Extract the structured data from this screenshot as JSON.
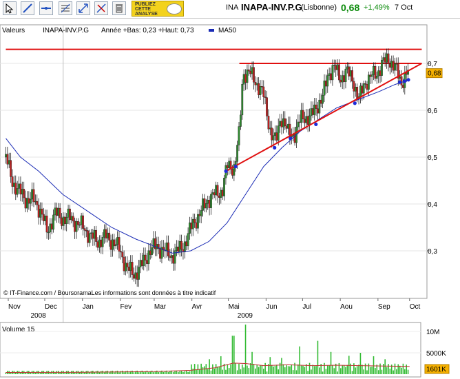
{
  "toolbar": {
    "tools": [
      "cursor-tool",
      "trendline-tool",
      "horizontal-line-tool",
      "fibonacci-tool",
      "resize-tool",
      "eraser-tool",
      "delete-tool"
    ],
    "ad_lines": [
      "PUBLIEZ",
      "CETTE",
      "ANALYSE"
    ]
  },
  "header": {
    "code": "INA",
    "name": "INAPA-INV.P.G",
    "market": "(Lisbonne)",
    "price": "0,68",
    "change": "+1,49%",
    "date": "7 Oct"
  },
  "colors": {
    "candle_up": "#2f8a2f",
    "candle_down": "#c02020",
    "ma": "#1a2bb5",
    "trendline": "#e01010",
    "volume_bar": "#33bb33",
    "volume_ma": "#c03030",
    "marker": "#1d2bd8",
    "price_tag": "#f5b000"
  },
  "chart_data": [
    {
      "type": "line",
      "subtype": "candlestick",
      "legend": {
        "label": "Valeurs",
        "symbol": "INAPA-INV.P.G",
        "range": "Année +Bas: 0,23 +Haut: 0,73",
        "ma_label": "MA50"
      },
      "ylim": [
        0.22,
        0.78
      ],
      "y_ticks": [
        "0,3",
        "0,4",
        "0,5",
        "0,6",
        "0,7"
      ],
      "y_tick_values": [
        0.3,
        0.4,
        0.5,
        0.6,
        0.7
      ],
      "x_range_days": 330,
      "x_month_labels": [
        "Nov",
        "Dec",
        "Jan",
        "Fev",
        "Mar",
        "Avr",
        "Mai",
        "Jun",
        "Jul",
        "Aou",
        "Sep",
        "Oct"
      ],
      "x_month_days": [
        0,
        30,
        61,
        92,
        120,
        151,
        181,
        212,
        242,
        273,
        304,
        330
      ],
      "x_year_labels": [
        "2008",
        "2009"
      ],
      "x_year_days": [
        15,
        185
      ],
      "last_price_label": "0,68",
      "copyright": "© IT-Finance.com / BoursoramaLes informations sont données à titre indicatif",
      "price_points": [
        [
          -2,
          0.5
        ],
        [
          3,
          0.45
        ],
        [
          8,
          0.43
        ],
        [
          14,
          0.41
        ],
        [
          20,
          0.41
        ],
        [
          26,
          0.39
        ],
        [
          32,
          0.34
        ],
        [
          38,
          0.38
        ],
        [
          44,
          0.37
        ],
        [
          50,
          0.37
        ],
        [
          56,
          0.36
        ],
        [
          62,
          0.35
        ],
        [
          68,
          0.33
        ],
        [
          74,
          0.32
        ],
        [
          80,
          0.33
        ],
        [
          86,
          0.32
        ],
        [
          92,
          0.3
        ],
        [
          98,
          0.26
        ],
        [
          104,
          0.25
        ],
        [
          110,
          0.27
        ],
        [
          116,
          0.3
        ],
        [
          122,
          0.31
        ],
        [
          128,
          0.3
        ],
        [
          134,
          0.29
        ],
        [
          140,
          0.3
        ],
        [
          146,
          0.32
        ],
        [
          152,
          0.36
        ],
        [
          158,
          0.38
        ],
        [
          164,
          0.41
        ],
        [
          170,
          0.42
        ],
        [
          176,
          0.43
        ],
        [
          180,
          0.48
        ],
        [
          186,
          0.48
        ],
        [
          190,
          0.55
        ],
        [
          193,
          0.68
        ],
        [
          198,
          0.68
        ],
        [
          204,
          0.66
        ],
        [
          210,
          0.63
        ],
        [
          216,
          0.55
        ],
        [
          220,
          0.53
        ],
        [
          224,
          0.59
        ],
        [
          230,
          0.55
        ],
        [
          236,
          0.55
        ],
        [
          242,
          0.59
        ],
        [
          248,
          0.58
        ],
        [
          253,
          0.61
        ],
        [
          258,
          0.62
        ],
        [
          263,
          0.68
        ],
        [
          268,
          0.69
        ],
        [
          273,
          0.67
        ],
        [
          278,
          0.68
        ],
        [
          283,
          0.67
        ],
        [
          288,
          0.62
        ],
        [
          293,
          0.66
        ],
        [
          298,
          0.67
        ],
        [
          303,
          0.68
        ],
        [
          308,
          0.7
        ],
        [
          313,
          0.71
        ],
        [
          318,
          0.69
        ],
        [
          323,
          0.66
        ],
        [
          328,
          0.68
        ],
        [
          330,
          0.68
        ]
      ],
      "ma50": [
        [
          -2,
          0.54
        ],
        [
          10,
          0.5
        ],
        [
          25,
          0.47
        ],
        [
          45,
          0.42
        ],
        [
          65,
          0.385
        ],
        [
          85,
          0.35
        ],
        [
          105,
          0.325
        ],
        [
          120,
          0.31
        ],
        [
          135,
          0.295
        ],
        [
          150,
          0.3
        ],
        [
          165,
          0.32
        ],
        [
          180,
          0.36
        ],
        [
          195,
          0.42
        ],
        [
          210,
          0.48
        ],
        [
          225,
          0.52
        ],
        [
          240,
          0.555
        ],
        [
          255,
          0.58
        ],
        [
          270,
          0.605
        ],
        [
          290,
          0.625
        ],
        [
          305,
          0.64
        ],
        [
          318,
          0.655
        ],
        [
          330,
          0.665
        ]
      ],
      "horizontal_levels": [
        {
          "y": 0.73,
          "from_day": -2,
          "to_day": 340
        },
        {
          "y": 0.7,
          "from_day": 190,
          "to_day": 340
        }
      ],
      "support_trendline": {
        "from": [
          179,
          0.47
        ],
        "to": [
          340,
          0.7
        ]
      },
      "touch_points": [
        [
          179,
          0.47
        ],
        [
          187,
          0.48
        ],
        [
          219,
          0.52
        ],
        [
          232,
          0.54
        ],
        [
          253,
          0.57
        ],
        [
          285,
          0.615
        ],
        [
          322,
          0.66
        ],
        [
          326,
          0.662
        ],
        [
          329,
          0.665
        ]
      ]
    },
    {
      "type": "bar",
      "title": "Volume 15",
      "y_ticks": [
        "10M",
        "5000K"
      ],
      "y_tick_values": [
        10000,
        5000
      ],
      "last_value_label": "1601K",
      "ylim": [
        0,
        12000
      ],
      "volume_ma": [
        [
          -2,
          400
        ],
        [
          60,
          450
        ],
        [
          120,
          600
        ],
        [
          150,
          900
        ],
        [
          170,
          1500
        ],
        [
          185,
          2600
        ],
        [
          195,
          2500
        ],
        [
          210,
          2000
        ],
        [
          230,
          2200
        ],
        [
          250,
          2000
        ],
        [
          270,
          2100
        ],
        [
          290,
          2000
        ],
        [
          310,
          1900
        ],
        [
          330,
          1800
        ]
      ],
      "spikes": [
        [
          165,
          3500
        ],
        [
          175,
          4200
        ],
        [
          185,
          9000
        ],
        [
          195,
          12300
        ],
        [
          200,
          5200
        ],
        [
          215,
          4000
        ],
        [
          225,
          3800
        ],
        [
          240,
          6500
        ],
        [
          255,
          7800
        ],
        [
          265,
          5200
        ],
        [
          280,
          4300
        ],
        [
          290,
          5000
        ],
        [
          300,
          4200
        ],
        [
          310,
          3500
        ]
      ]
    }
  ]
}
